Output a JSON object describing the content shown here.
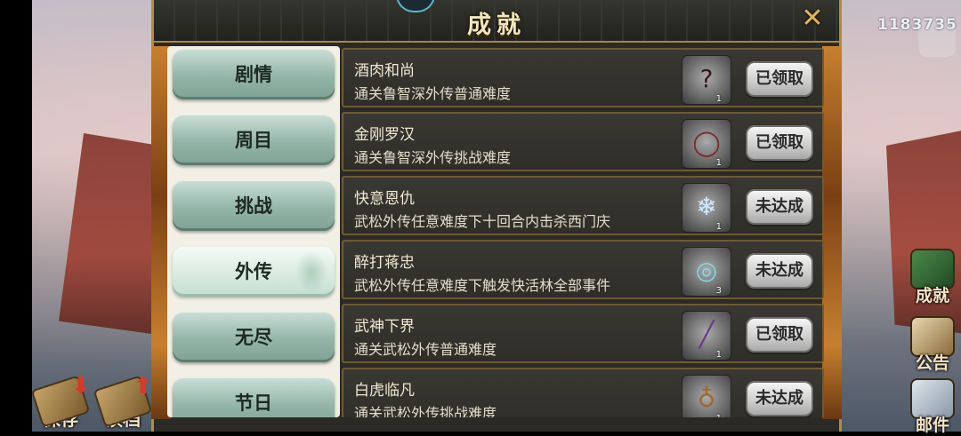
{
  "header": {
    "title": "成就",
    "close_icon": "crossed-swords-icon"
  },
  "score": "1183735",
  "tabs": [
    {
      "label": "剧情",
      "active": false
    },
    {
      "label": "周目",
      "active": false
    },
    {
      "label": "挑战",
      "active": false
    },
    {
      "label": "外传",
      "active": true
    },
    {
      "label": "无尽",
      "active": false
    },
    {
      "label": "节日",
      "active": false
    }
  ],
  "achievements": [
    {
      "name": "酒肉和尚",
      "desc": "通关鲁智深外传普通难度",
      "reward_icon": "monk-silhouette-icon",
      "reward_glyph": "?",
      "reward_count": "1",
      "status": "已领取"
    },
    {
      "name": "金刚罗汉",
      "desc": "通关鲁智深外传挑战难度",
      "reward_icon": "prayer-beads-icon",
      "reward_glyph": "◯",
      "reward_count": "1",
      "status": "已领取"
    },
    {
      "name": "快意恩仇",
      "desc": "武松外传任意难度下十回合内击杀西门庆",
      "reward_icon": "ice-crystal-icon",
      "reward_glyph": "❄",
      "reward_count": "1",
      "status": "未达成"
    },
    {
      "name": "醉打蒋忠",
      "desc": "武松外传任意难度下触发快活林全部事件",
      "reward_icon": "wine-bucket-icon",
      "reward_glyph": "◎",
      "reward_count": "3",
      "status": "未达成"
    },
    {
      "name": "武神下界",
      "desc": "通关武松外传普通难度",
      "reward_icon": "staff-icon",
      "reward_glyph": "╱",
      "reward_count": "1",
      "status": "已领取"
    },
    {
      "name": "白虎临凡",
      "desc": "通关武松外传挑战难度",
      "reward_icon": "gourd-icon",
      "reward_glyph": "♁",
      "reward_count": "1",
      "status": "未达成"
    }
  ],
  "left_buttons": [
    {
      "label": "保存",
      "icon": "save-scroll-icon"
    },
    {
      "label": "读档",
      "icon": "load-scroll-icon"
    }
  ],
  "right_buttons": [
    {
      "label": "成就",
      "icon": "achievement-book-icon"
    },
    {
      "label": "公告",
      "icon": "notice-board-icon"
    },
    {
      "label": "邮件",
      "icon": "mail-envelope-icon"
    }
  ],
  "colors": {
    "panel": "#2b2a26",
    "gold_border": "#b38a44",
    "tab_green": "#93b4a8",
    "title_text": "#f3e6b8"
  }
}
